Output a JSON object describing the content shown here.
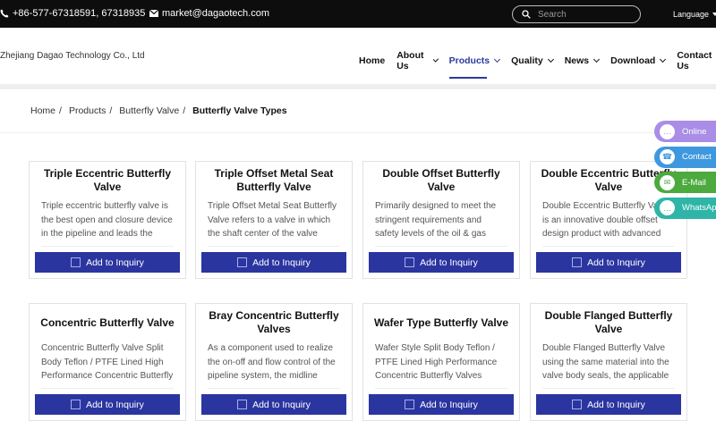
{
  "topbar": {
    "phone": "+86-577-67318591, 67318935",
    "email": "market@dagaotech.com",
    "search_placeholder": "Search",
    "language": "Language"
  },
  "header": {
    "company": "Zhejiang Dagao Technology Co., Ltd",
    "nav": [
      {
        "label": "Home",
        "dropdown": false,
        "active": false
      },
      {
        "label": "About Us",
        "dropdown": true,
        "active": false
      },
      {
        "label": "Products",
        "dropdown": true,
        "active": true
      },
      {
        "label": "Quality",
        "dropdown": true,
        "active": false
      },
      {
        "label": "News",
        "dropdown": true,
        "active": false
      },
      {
        "label": "Download",
        "dropdown": true,
        "active": false
      },
      {
        "label": "Contact Us",
        "dropdown": false,
        "active": false
      }
    ]
  },
  "breadcrumb": [
    "Home",
    "Products",
    "Butterfly Valve",
    "Butterfly Valve Types"
  ],
  "products": [
    {
      "title": "Triple Eccentric Butterfly Valve",
      "desc": "Triple eccentric butterfly valve is the best open and closure device in the pipeline and leads the"
    },
    {
      "title": "Triple Offset Metal Seat Butterfly Valve",
      "desc": "Triple Offset Metal Seat Butterfly Valve refers to a valve in which the shaft center of the valve"
    },
    {
      "title": "Double Offset Butterfly Valve",
      "desc": "Primarily designed to meet the stringent requirements and safety levels of the oil & gas industry,"
    },
    {
      "title": "Double Eccentric Butterfly Valve",
      "desc": "Double Eccentric Butterfly Valve is an innovative double offset design product with advanced world"
    },
    {
      "title": "Concentric Butterfly Valve",
      "desc": "Concentric Butterfly Valve Split Body Teflon / PTFE Lined High Performance Concentric Butterfly"
    },
    {
      "title": "Bray Concentric Butterfly Valves",
      "desc": "As a component used to realize the on-off and flow control of the pipeline system, the midline"
    },
    {
      "title": "Wafer Type Butterfly Valve",
      "desc": "Wafer Style Split Body Teflon / PTFE Lined High Performance Concentric Butterfly Valves Resilient"
    },
    {
      "title": "Double Flanged Butterfly Valve",
      "desc": "Double Flanged Butterfly Valve using the same material into the valve body seals, the applicable"
    }
  ],
  "inquiry_label": "Add to Inquiry",
  "floating": [
    {
      "label": "Online",
      "color": "#a98de6",
      "icon": "chat-icon"
    },
    {
      "label": "Contact",
      "color": "#3d98e0",
      "icon": "phone-icon"
    },
    {
      "label": "E-Mail",
      "color": "#4caa3e",
      "icon": "mail-icon"
    },
    {
      "label": "WhatsApp",
      "color": "#2fb5a8",
      "icon": "whatsapp-icon"
    }
  ]
}
